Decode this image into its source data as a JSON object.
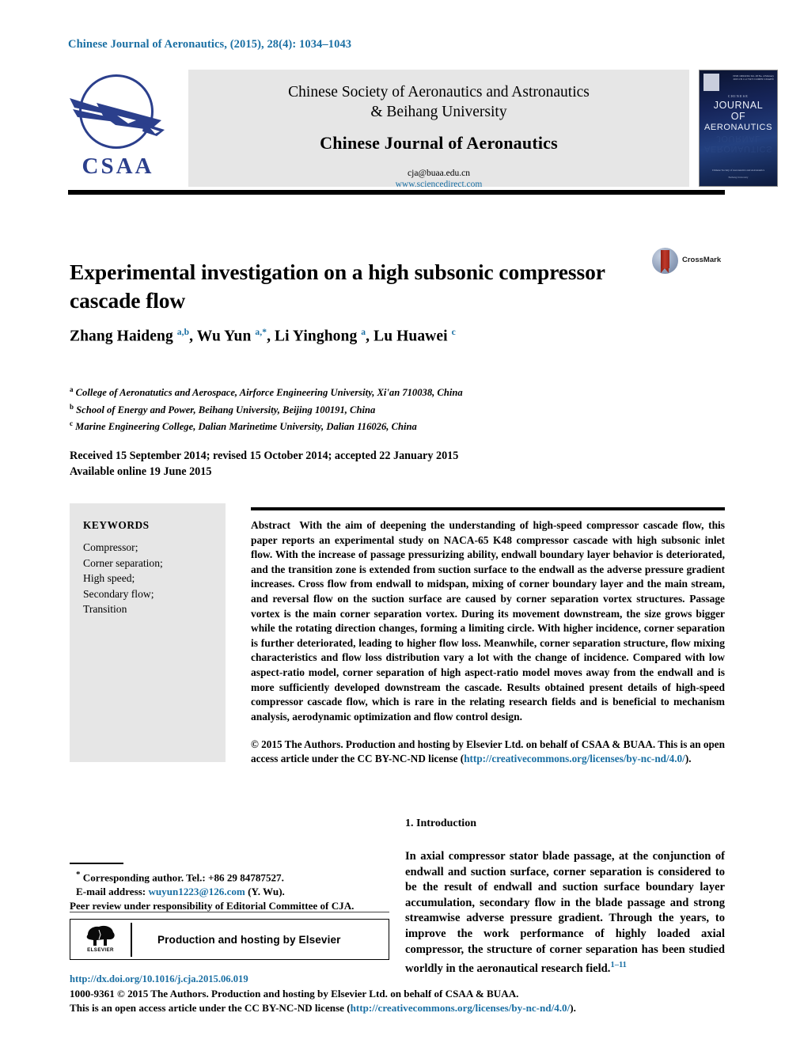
{
  "running_head": "Chinese Journal of Aeronautics, (2015), 28(4): 1034–1043",
  "header": {
    "logo_text": "CSAA",
    "society_line1": "Chinese Society of Aeronautics and Astronautics",
    "society_line2": "& Beihang University",
    "journal_name": "Chinese Journal of Aeronautics",
    "email": "cja@buaa.edu.cn",
    "url": "www.sciencedirect.com",
    "cover": {
      "issn": "ISSN 1000-9361\nVol. 28 No. 4  February 2015\nCN 11-1732/V  CODEN CJOAEW",
      "chinese_label": "CHINESE",
      "title_line1": "JOURNAL",
      "title_line2": "OF",
      "title_line3": "AERONAUTICS",
      "foot_line1": "Chinese Society of Aeronautics and Astronautics",
      "foot_line2": "Beihang University"
    }
  },
  "article": {
    "title": "Experimental investigation on a high subsonic compressor cascade flow",
    "crossmark_label": "CrossMark",
    "authors_html": "Zhang Haideng <sup>a,b</sup>, Wu Yun <sup>a,*</sup>, Li Yinghong <sup>a</sup>, Lu Huawei <sup>c</sup>",
    "affiliations": [
      {
        "mark": "a",
        "text": "College of Aeronatutics and Aerospace, Airforce Engineering University, Xi'an 710038, China"
      },
      {
        "mark": "b",
        "text": "School of Energy and Power, Beihang University, Beijing 100191, China"
      },
      {
        "mark": "c",
        "text": "Marine Engineering College, Dalian Marinetime University, Dalian 116026, China"
      }
    ],
    "received_line": "Received 15 September 2014; revised 15 October 2014; accepted 22 January 2015",
    "available_line": "Available online 19 June 2015"
  },
  "keywords": {
    "heading": "KEYWORDS",
    "items": [
      "Compressor;",
      "Corner separation;",
      "High speed;",
      "Secondary flow;",
      "Transition"
    ]
  },
  "abstract": {
    "label": "Abstract",
    "body": "With the aim of deepening the understanding of high-speed compressor cascade flow, this paper reports an experimental study on NACA-65 K48 compressor cascade with high subsonic inlet flow. With the increase of passage pressurizing ability, endwall boundary layer behavior is deteriorated, and the transition zone is extended from suction surface to the endwall as the adverse pressure gradient increases. Cross flow from endwall to midspan, mixing of corner boundary layer and the main stream, and reversal flow on the suction surface are caused by corner separation vortex structures. Passage vortex is the main corner separation vortex. During its movement downstream, the size grows bigger while the rotating direction changes, forming a limiting circle. With higher incidence, corner separation is further deteriorated, leading to higher flow loss. Meanwhile, corner separation structure, flow mixing characteristics and flow loss distribution vary a lot with the change of incidence. Compared with low aspect-ratio model, corner separation of high aspect-ratio model moves away from the endwall and is more sufficiently developed downstream the cascade. Results obtained present details of high-speed compressor cascade flow, which is rare in the relating research fields and is beneficial to mechanism analysis, aerodynamic optimization and flow control design.",
    "copyright_pre": "© 2015 The Authors. Production and hosting by Elsevier Ltd. on behalf of CSAA & BUAA.  This is an open access article under the CC BY-NC-ND license (",
    "copyright_link": "http://creativecommons.org/licenses/by-nc-nd/4.0/",
    "copyright_post": ")."
  },
  "introduction": {
    "heading": "1. Introduction",
    "paragraph_pre": "In axial compressor stator blade passage, at the conjunction of endwall and suction surface, corner separation is considered to be the result of endwall and suction surface boundary layer accumulation, secondary flow in the blade passage and strong streamwise adverse pressure gradient. Through the years, to improve the work performance of highly loaded axial compressor, the structure of corner separation has been studied worldly in the aeronautical research field.",
    "reference_marks": "1–11"
  },
  "footnote": {
    "corresponding": "Corresponding author. Tel.: +86 29 84787527.",
    "email_label": "E-mail address:",
    "email_link": "wuyun1223@126.com",
    "email_suffix": "(Y. Wu).",
    "peer_review": "Peer review under responsibility of Editorial Committee of CJA."
  },
  "elsevier_box": {
    "logo_word": "ELSEVIER",
    "text": "Production and hosting by Elsevier"
  },
  "footer": {
    "doi": "http://dx.doi.org/10.1016/j.cja.2015.06.019",
    "line1": "1000-9361 © 2015 The Authors. Production and hosting by Elsevier Ltd. on behalf of CSAA & BUAA.",
    "line2_pre": "This is an open access article under the CC BY-NC-ND license (",
    "line2_link": "http://creativecommons.org/licenses/by-nc-nd/4.0/",
    "line2_post": ")."
  },
  "colors": {
    "link_blue": "#1a6fa3",
    "logo_blue": "#2b3f8c",
    "grey_panel": "#e6e6e6",
    "crossmark_red": "#c0392b"
  }
}
